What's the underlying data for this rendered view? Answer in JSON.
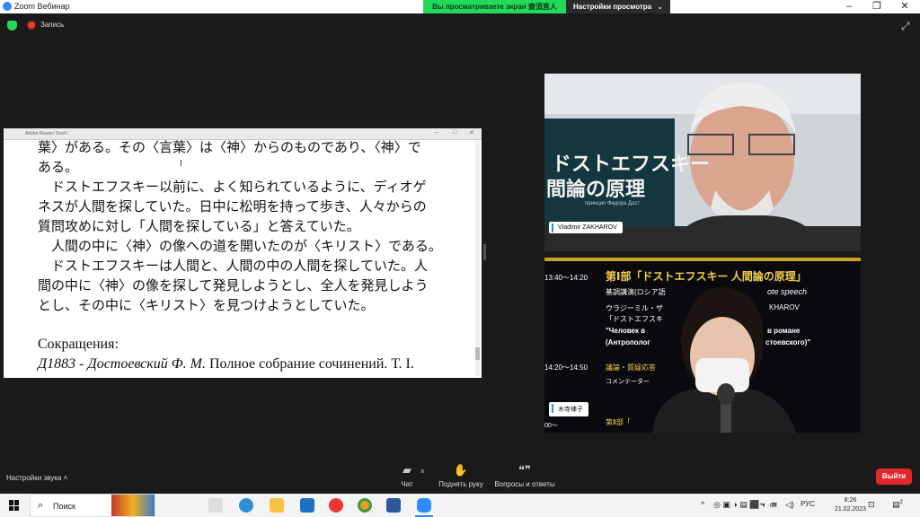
{
  "window": {
    "title": "Zoom Вебинар",
    "minimize": "–",
    "restore": "❐",
    "close": "✕"
  },
  "share_banner": {
    "status": "Вы  просматриваете  экран 齋須直人",
    "view_settings": "Настройки просмотра",
    "chevron": "⌄"
  },
  "topbar": {
    "record_label": "Запись",
    "shield_icon": "shield-check-icon",
    "expand_icon": "fullscreen-icon"
  },
  "document": {
    "title": "Adobe Reader Touch",
    "lines_jp": [
      "葉〉がある。その〈言葉〉は〈神〉からのものであり、〈神〉で",
      "ある。",
      "　ドストエフスキー以前に、よく知られているように、ディオゲ",
      "ネスが人間を探していた。日中に松明を持って歩き、人々からの",
      "質問攻めに対し「人間を探している」と答えていた。",
      "　人間の中に〈神〉の像への道を開いたのが〈キリスト〉である。",
      "　ドストエフスキーは人間と、人間の中の人間を探していた。人",
      "間の中に〈神〉の像を探して発見しようとし、全人を発見しよう",
      "とし、その中に〈キリスト〉を見つけようとしていた。"
    ],
    "abbrev_heading": "Сокращения:",
    "abbrev_key": "Д1883  - Достоевский Ф. М.",
    "abbrev_text": " Полное собрание сочинений. Т. I."
  },
  "participants": [
    {
      "name": "Vladimir ZAKHAROV"
    },
    {
      "name": "木寺律子"
    }
  ],
  "slide_text": {
    "banner1": "ドストエフスキー",
    "banner2": "間論の原理",
    "principle": "принцип Федора Дост",
    "time1": "13:40〜14:20",
    "part1": "第Ⅰ部「ドストエフスキー 人間論の原理」",
    "keynote": "基調講演(ロシア語",
    "keynote2": "ote speech",
    "speaker1": "ウラジーミル・ザ",
    "speaker1b": "KHAROV",
    "talk1": "「ドストエフスキ",
    "talk2": "\"Человек в",
    "talk2b": "в романе",
    "talk3": "(Антрополог",
    "talk3b": "стоевского)\"",
    "time2": "14:20〜14:50",
    "qa": "議論・質疑応答",
    "commentator": "コメンテーター",
    "time3": "00〜",
    "part2": "第Ⅱ部「"
  },
  "toolbar": {
    "sound_settings": "Настройки звука",
    "chat": "Чат",
    "raise_hand": "Поднять руку",
    "qa": "Вопросы и ответы",
    "exit": "Выйти"
  },
  "taskbar": {
    "search_placeholder": "Поиск",
    "lang": "РУС",
    "time": "8:26",
    "date": "21.02.2023",
    "notif_count": "2",
    "chevron": "^"
  },
  "colors": {
    "zoom_blue": "#2d8cff",
    "share_green": "#23d959",
    "exit_red": "#e02828"
  }
}
